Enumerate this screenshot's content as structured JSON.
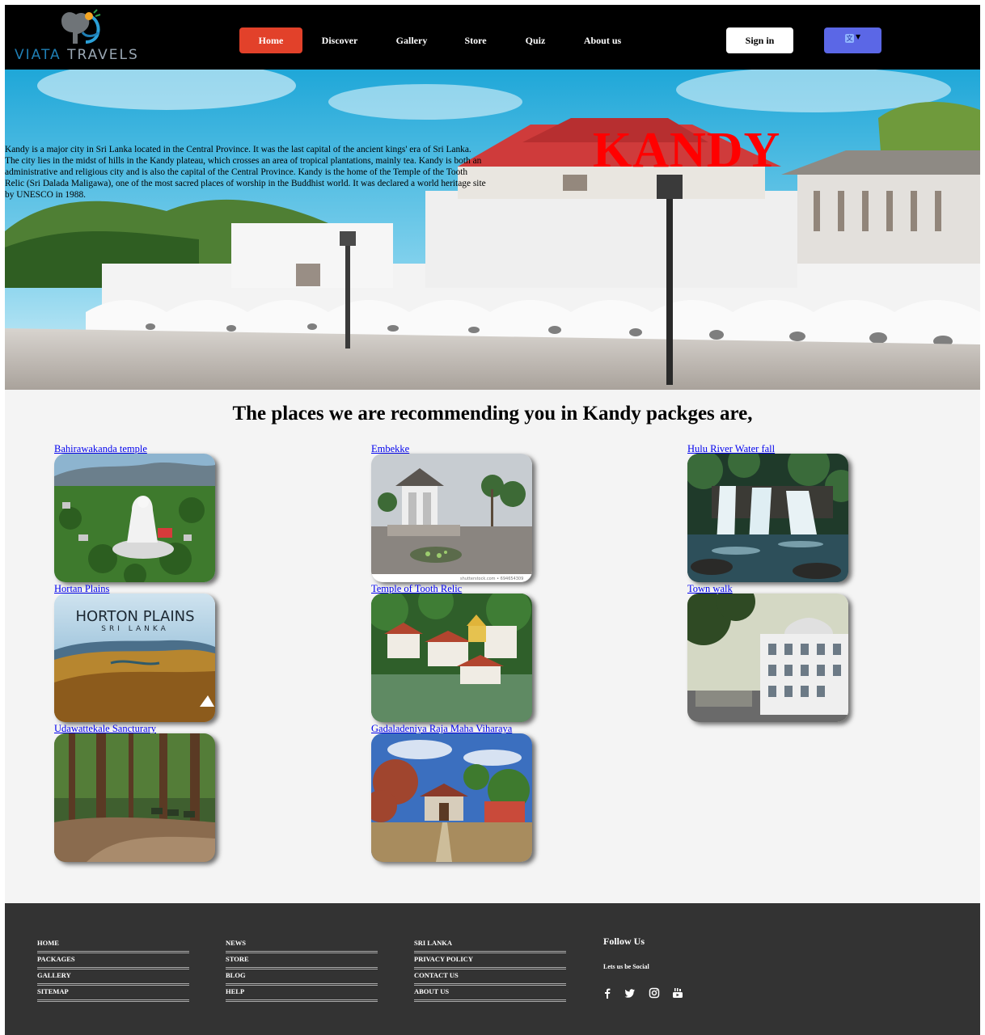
{
  "header": {
    "logo_text_primary": "VIATA",
    "logo_text_secondary": "TRAVELS",
    "nav": [
      {
        "label": "Home",
        "active": true
      },
      {
        "label": "Discover",
        "active": false
      },
      {
        "label": "Gallery",
        "active": false
      },
      {
        "label": "Store",
        "active": false
      },
      {
        "label": "Quiz",
        "active": false
      },
      {
        "label": "About us",
        "active": false
      }
    ],
    "signin_label": "Sign in",
    "language_icon": "translate-icon",
    "colors": {
      "active_nav": "#e2412a",
      "language_button": "#5b67e6"
    }
  },
  "hero": {
    "title": "KANDY",
    "description": "Kandy is a major city in Sri Lanka located in the Central Province. It was the last capital of the ancient kings' era of Sri Lanka. The city lies in the midst of hills in the Kandy plateau, which crosses an area of tropical plantations, mainly tea. Kandy is both an administrative and religious city and is also the capital of the Central Province. Kandy is the home of the Temple of the Tooth Relic (Sri Dalada Maligawa), one of the most sacred places of worship in the Buddhist world. It was declared a world heritage site by UNESCO in 1988.",
    "title_color": "#ff0000"
  },
  "recommendations": {
    "title": "The places we are recommending you in Kandy packges are,",
    "places": [
      {
        "name": "Bahirawakanda temple"
      },
      {
        "name": "Embekke",
        "watermark": "shutterstock.com • 694654309"
      },
      {
        "name": "Hulu River Water fall"
      },
      {
        "name": "Hortan Plains",
        "image_title": "HORTON PLAINS",
        "image_subtitle": "SRI LANKA"
      },
      {
        "name": "Temple of Tooth Relic"
      },
      {
        "name": "Town walk"
      },
      {
        "name": "Udawattekale Sancturary"
      },
      {
        "name": "Gadaladeniya Raja Maha Viharaya"
      }
    ]
  },
  "footer": {
    "columns": [
      [
        "HOME",
        "PACKAGES",
        "GALLERY",
        "SITEMAP"
      ],
      [
        "NEWS",
        "STORE",
        "BLOG",
        "HELP"
      ],
      [
        "SRI LANKA",
        "PRIVACY POLICY",
        "CONTACT US",
        "ABOUT US"
      ]
    ],
    "follow_title": "Follow Us",
    "follow_subtitle": "Lets us be Social",
    "social_icons": [
      "facebook-icon",
      "twitter-icon",
      "instagram-icon",
      "youtube-icon"
    ]
  }
}
